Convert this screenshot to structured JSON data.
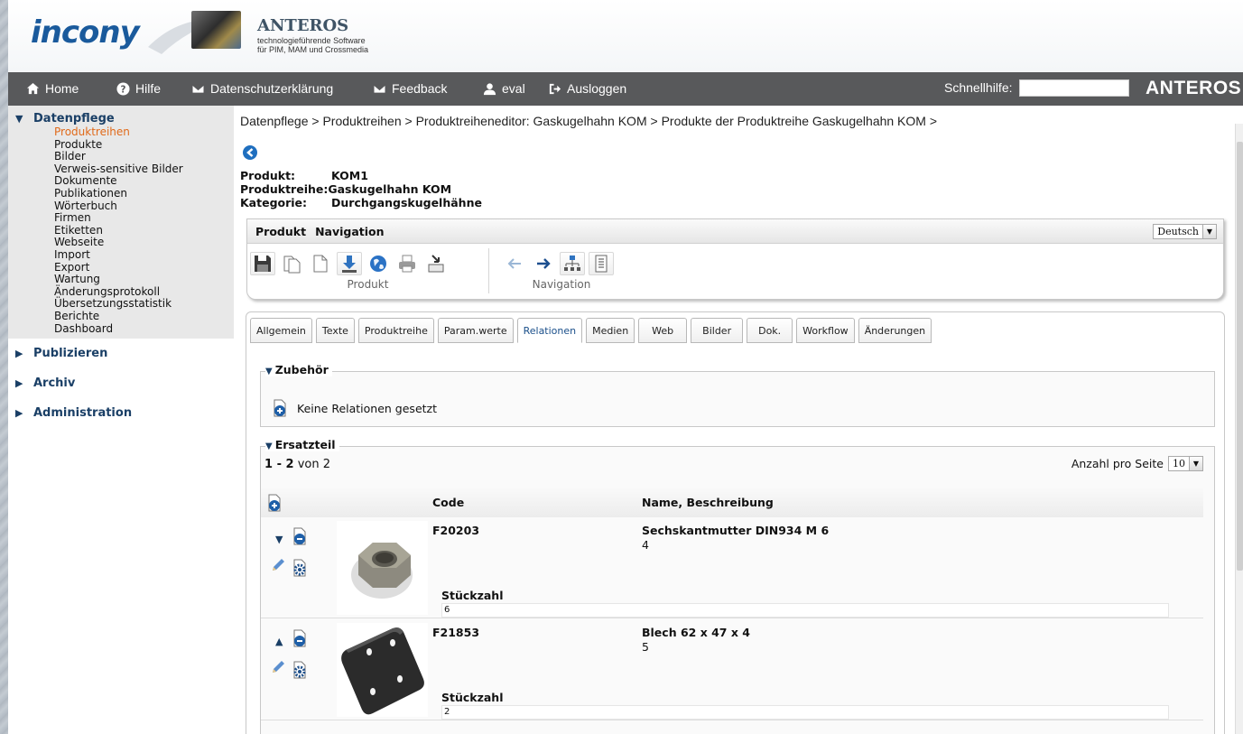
{
  "header": {
    "logo": "incony",
    "brand_title": "ANTEROS",
    "brand_sub_1": "technologieführende Software",
    "brand_sub_2": "für PIM, MAM und Crossmedia"
  },
  "nav": {
    "home": "Home",
    "help": "Hilfe",
    "privacy": "Datenschutzerklärung",
    "feedback": "Feedback",
    "user": "eval",
    "logout": "Ausloggen",
    "quickhelp_label": "Schnellhilfe:",
    "quickhelp_value": "",
    "app_name": "ANTEROS"
  },
  "sidebar": {
    "open_section": "Datenpflege",
    "items": [
      {
        "label": "Produktreihen",
        "active": true
      },
      {
        "label": "Produkte"
      },
      {
        "label": "Bilder"
      },
      {
        "label": "Verweis-sensitive Bilder"
      },
      {
        "label": "Dokumente"
      },
      {
        "label": "Publikationen"
      },
      {
        "label": "Wörterbuch"
      },
      {
        "label": "Firmen"
      },
      {
        "label": "Etiketten"
      },
      {
        "label": "Webseite"
      },
      {
        "label": "Import"
      },
      {
        "label": "Export"
      },
      {
        "label": "Wartung"
      },
      {
        "label": "Änderungsprotokoll"
      },
      {
        "label": "Übersetzungsstatistik"
      },
      {
        "label": "Berichte"
      },
      {
        "label": "Dashboard"
      }
    ],
    "closed_sections": [
      "Publizieren",
      "Archiv",
      "Administration"
    ]
  },
  "breadcrumb": "Datenpflege > Produktreihen > Produktreiheneditor: Gaskugelhahn KOM > Produkte der Produktreihe Gaskugelhahn KOM >",
  "info": {
    "produkt_label": "Produkt:",
    "produkt_value": "KOM1",
    "reihe_label": "Produktreihe:",
    "reihe_value": "Gaskugelhahn KOM",
    "kategorie_label": "Kategorie:",
    "kategorie_value": "Durchgangskugelhähne"
  },
  "toolbar": {
    "menu_produkt": "Produkt",
    "menu_navigation": "Navigation",
    "language": "Deutsch",
    "group_produkt": "Produkt",
    "group_navigation": "Navigation",
    "produkt_icons": [
      "save-icon",
      "copy-document-icon",
      "new-document-icon",
      "download-icon",
      "globe-icon",
      "print-icon",
      "import-icon"
    ],
    "navigation_icons": [
      "arrow-left-icon",
      "arrow-right-icon",
      "hierarchy-icon",
      "list-icon"
    ]
  },
  "tabs": [
    "Allgemein",
    "Texte",
    "Produktreihe",
    "Param.werte",
    "Relationen",
    "Medien",
    "Web",
    "Bilder",
    "Dok.",
    "Workflow",
    "Änderungen"
  ],
  "active_tab": "Relationen",
  "zubehoer": {
    "title": "Zubehör",
    "empty_text": "Keine Relationen gesetzt"
  },
  "ersatzteil": {
    "title": "Ersatzteil",
    "pager_range": "1 - 2",
    "pager_of": "von 2",
    "per_page_label": "Anzahl pro Seite",
    "per_page_value": "10",
    "col_code": "Code",
    "col_name": "Name, Beschreibung",
    "qty_label": "Stückzahl",
    "rows": [
      {
        "code": "F20203",
        "name": "Sechskantmutter DIN934 M 6",
        "number": "4",
        "qty": "6",
        "image": "hex-nut"
      },
      {
        "code": "F21853",
        "name": "Blech 62 x 47 x 4",
        "number": "5",
        "qty": "2",
        "image": "metal-plate"
      }
    ]
  },
  "colors": {
    "nav_bg": "#58595b",
    "accent_blue": "#1a3f66",
    "active_orange": "#e06a1a",
    "logo_blue": "#1a5a9c"
  }
}
